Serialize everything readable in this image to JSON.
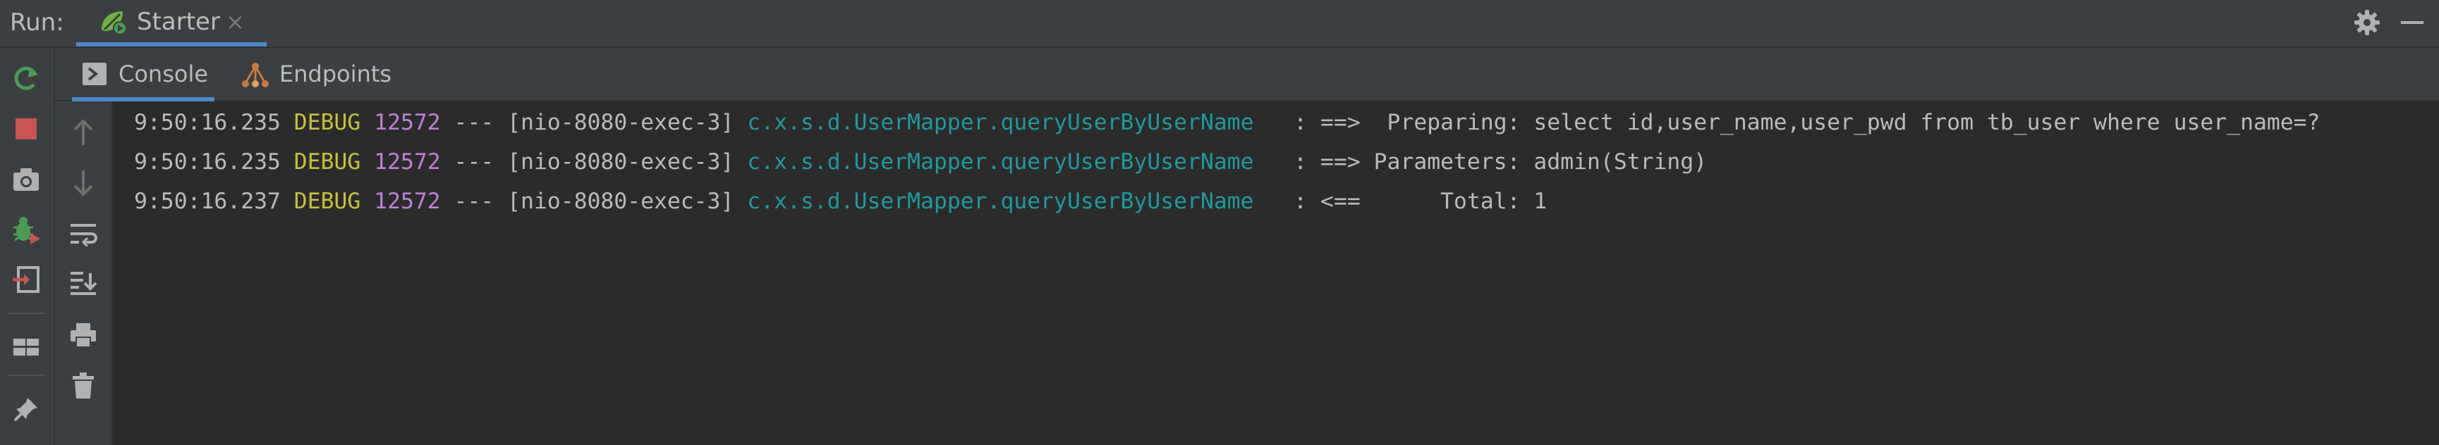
{
  "run": {
    "label": "Run:",
    "tab": {
      "name": "Starter",
      "close": "×",
      "icon": "spring-boot-run-icon"
    }
  },
  "colors": {
    "accent": "#4a88c7",
    "level_debug": "#c3c33c",
    "pid": "#bf7fd9",
    "logger": "#20999d",
    "text": "#bbbbbb",
    "stop": "#c75450",
    "rerun": "#499c54"
  },
  "subtabs": [
    {
      "label": "Console",
      "icon": "console-icon",
      "active": true
    },
    {
      "label": "Endpoints",
      "icon": "endpoints-icon",
      "active": false
    }
  ],
  "left_toolbar": [
    "rerun-icon",
    "stop-icon",
    "camera-icon",
    "debug-restart-icon",
    "exit-icon",
    "layout-icon",
    "pin-icon"
  ],
  "console_toolbar": [
    "up-arrow-icon",
    "down-arrow-icon",
    "soft-wrap-icon",
    "scroll-to-end-icon",
    "print-icon",
    "trash-icon"
  ],
  "log_lines": [
    {
      "time": "9:50:16.235",
      "level": "DEBUG",
      "pid": "12572",
      "thread": "--- [nio-8080-exec-3]",
      "logger": "c.x.s.d.UserMapper.queryUserByUserName",
      "message": "  : ==>  Preparing: select id,user_name,user_pwd from tb_user where user_name=?"
    },
    {
      "time": "9:50:16.235",
      "level": "DEBUG",
      "pid": "12572",
      "thread": "--- [nio-8080-exec-3]",
      "logger": "c.x.s.d.UserMapper.queryUserByUserName",
      "message": "  : ==> Parameters: admin(String)"
    },
    {
      "time": "9:50:16.237",
      "level": "DEBUG",
      "pid": "12572",
      "thread": "--- [nio-8080-exec-3]",
      "logger": "c.x.s.d.UserMapper.queryUserByUserName",
      "message": "  : <==      Total: 1"
    }
  ]
}
